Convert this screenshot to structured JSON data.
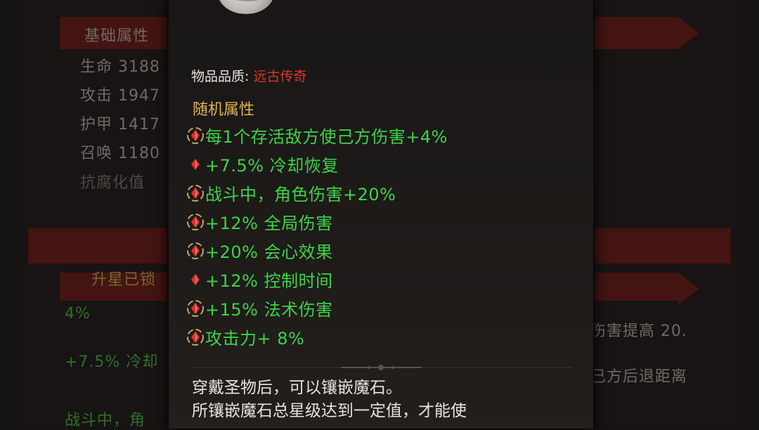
{
  "background": {
    "base_stats_header": "基础属性",
    "base_stats": [
      {
        "label": "生命 3188"
      },
      {
        "label": "攻击 1947"
      },
      {
        "label": "护甲 1417"
      },
      {
        "label": "召唤 1180"
      },
      {
        "label": "抗腐化值"
      }
    ],
    "star_header": "升星已锁",
    "left_green": [
      "4%",
      "+7.5% 冷却",
      "战斗中，角"
    ],
    "right_texts": [
      "伤害提高 20.",
      "己方后退距离"
    ]
  },
  "tooltip": {
    "quality_label": "物品品质:",
    "quality_value": "远古传奇",
    "random_attrs_title": "随机属性",
    "attributes": [
      {
        "text": "每1个存活敌方使己方伤害+4%",
        "icon": "framed"
      },
      {
        "text": "+7.5% 冷却恢复",
        "icon": "plain"
      },
      {
        "text": "战斗中，角色伤害+20%",
        "icon": "framed"
      },
      {
        "text": "+12% 全局伤害",
        "icon": "framed"
      },
      {
        "text": "+20% 会心效果",
        "icon": "framed"
      },
      {
        "text": "+12% 控制时间",
        "icon": "plain"
      },
      {
        "text": "+15% 法术伤害",
        "icon": "framed"
      },
      {
        "text": "攻击力+ 8%",
        "icon": "framed"
      }
    ],
    "description_lines": [
      "穿戴圣物后，可以镶嵌魔石。",
      "所镶嵌魔石总星级达到一定值，才能使"
    ]
  },
  "colors": {
    "attribute_green": "#3fd24a",
    "quality_red": "#e0322a",
    "title_gold": "#e0b554",
    "gem_red": "#e0302a"
  }
}
